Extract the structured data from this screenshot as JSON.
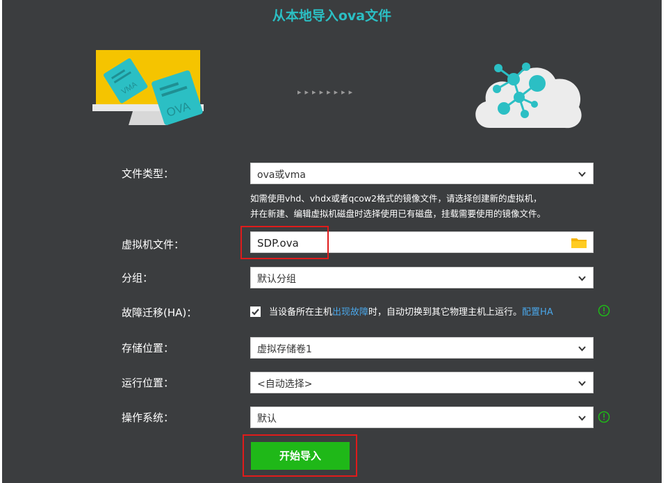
{
  "dialog": {
    "title": "从本地导入ova文件"
  },
  "illustration": {
    "vma_label": "VMA",
    "ova_label": "OVA",
    "arrows": "▸▸▸▸▸▸▸▸"
  },
  "form": {
    "file_type": {
      "label": "文件类型：",
      "value": "ova或vma"
    },
    "hint_line1": "如需使用vhd、vhdx或者qcow2格式的镜像文件，请选择创建新的虚拟机，",
    "hint_line2": "并在新建、编辑虚拟机磁盘时选择使用已有磁盘，挂载需要使用的镜像文件。",
    "vm_file": {
      "label": "虚拟机文件：",
      "value": "SDP.ova"
    },
    "group": {
      "label": "分组：",
      "value": "默认分组"
    },
    "ha": {
      "label": "故障迁移(HA)：",
      "text_before": "当设备所在主机",
      "link_fault": "出现故障",
      "text_after": "时，自动切换到其它物理主机上运行。",
      "link_config": "配置HA",
      "checked": true
    },
    "storage": {
      "label": "存储位置：",
      "value": "虚拟存储卷1"
    },
    "run_location": {
      "label": "运行位置：",
      "value": "<自动选择>"
    },
    "os": {
      "label": "操作系统：",
      "value": "默认"
    }
  },
  "actions": {
    "start_import": "开始导入"
  },
  "colors": {
    "accent": "#2bbfc4",
    "panel": "#3b3d3f",
    "primary_button": "#1fb818",
    "highlight": "#e01b1b",
    "link": "#4aa6e8"
  }
}
